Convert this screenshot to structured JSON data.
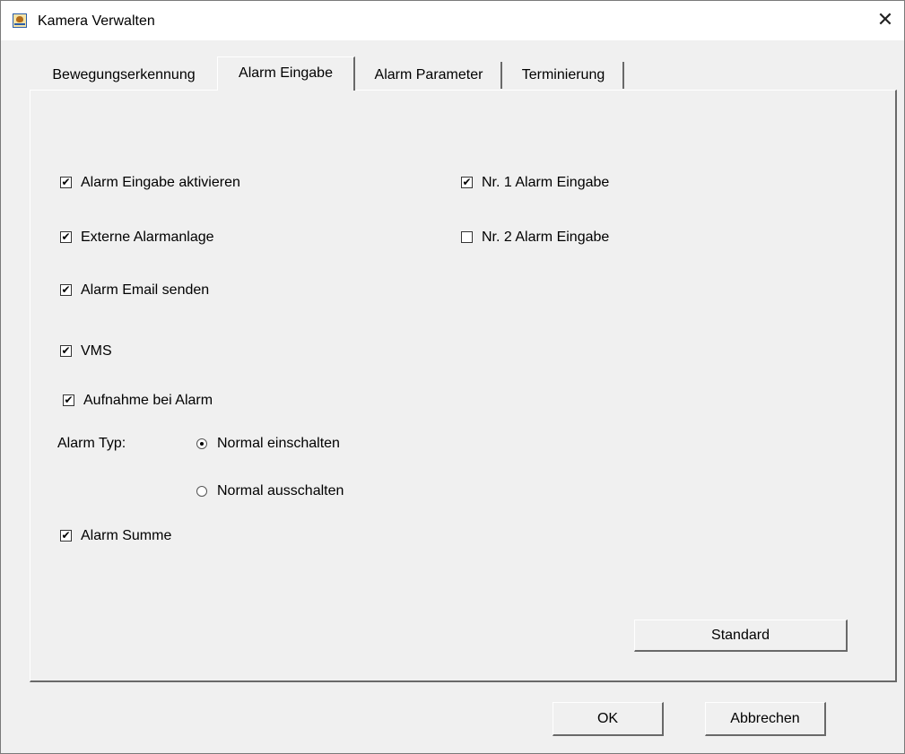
{
  "window": {
    "title": "Kamera Verwalten",
    "title_icon": "camera-app-icon",
    "close_symbol": "✕"
  },
  "tabs": [
    {
      "label": "Bewegungserkennung",
      "selected": false
    },
    {
      "label": "Alarm Eingabe",
      "selected": true
    },
    {
      "label": "Alarm Parameter",
      "selected": false
    },
    {
      "label": "Terminierung",
      "selected": false
    }
  ],
  "left_options": [
    {
      "label": "Alarm Eingabe aktivieren",
      "checked": true
    },
    {
      "label": "Externe Alarmanlage",
      "checked": true
    },
    {
      "label": "Alarm Email senden",
      "checked": true
    },
    {
      "label": "VMS",
      "checked": true
    },
    {
      "label": "Aufnahme bei Alarm",
      "checked": true
    }
  ],
  "alarm_type": {
    "label": "Alarm Typ:",
    "options": [
      {
        "label": "Normal einschalten",
        "selected": true
      },
      {
        "label": "Normal ausschalten",
        "selected": false
      }
    ]
  },
  "alarm_summe": {
    "label": "Alarm Summe",
    "checked": true
  },
  "right_options": [
    {
      "label": "Nr. 1 Alarm Eingabe",
      "checked": true
    },
    {
      "label": "Nr. 2 Alarm Eingabe",
      "checked": false
    }
  ],
  "buttons": {
    "standard": "Standard",
    "ok": "OK",
    "cancel": "Abbrechen"
  },
  "check_mark": "✔"
}
